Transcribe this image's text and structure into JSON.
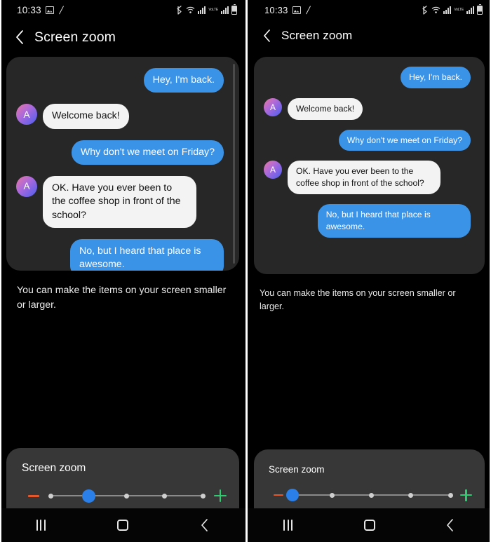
{
  "divider_color": "#ffffff",
  "page_background": "#000000",
  "accent": {
    "outgoing_bubble": "#3b93e8",
    "incoming_bubble": "#f3f3f3",
    "slider_thumb": "#2a7fe8",
    "minus_icon": "#e4572b",
    "plus_icon": "#2ecc71",
    "card_background": "#272727",
    "slider_card_background": "#373737"
  },
  "status_bar": {
    "time": "10:33",
    "icons_left": [
      "image-icon",
      "backslash-icon"
    ],
    "icons_right": [
      "bluetooth-icon",
      "wifi-icon",
      "signal-bars-icon",
      "volte-icon",
      "signal-bars-icon",
      "battery-icon"
    ],
    "volte_label": "VoLTE"
  },
  "header": {
    "back_icon": "chevron-left-icon",
    "title": "Screen zoom"
  },
  "conversation": {
    "avatar_initial": "A",
    "messages": [
      {
        "side": "out",
        "text": "Hey, I'm back."
      },
      {
        "side": "in",
        "text": "Welcome back!"
      },
      {
        "side": "out",
        "text": "Why don't we meet on Friday?"
      },
      {
        "side": "in",
        "text": "OK. Have you ever been to the coffee shop in front of the school?"
      },
      {
        "side": "out",
        "text": "No, but I heard that place is awesome."
      }
    ]
  },
  "description": "You can make the items on your screen smaller or larger.",
  "slider_panel": {
    "label": "Screen zoom",
    "minus_icon": "minus-icon",
    "plus_icon": "plus-icon",
    "steps": 5,
    "value_left": 1,
    "value_right": 0
  },
  "nav_bar": {
    "recents_icon": "recents-icon",
    "home_icon": "home-icon",
    "back_icon": "back-chevron-icon"
  }
}
